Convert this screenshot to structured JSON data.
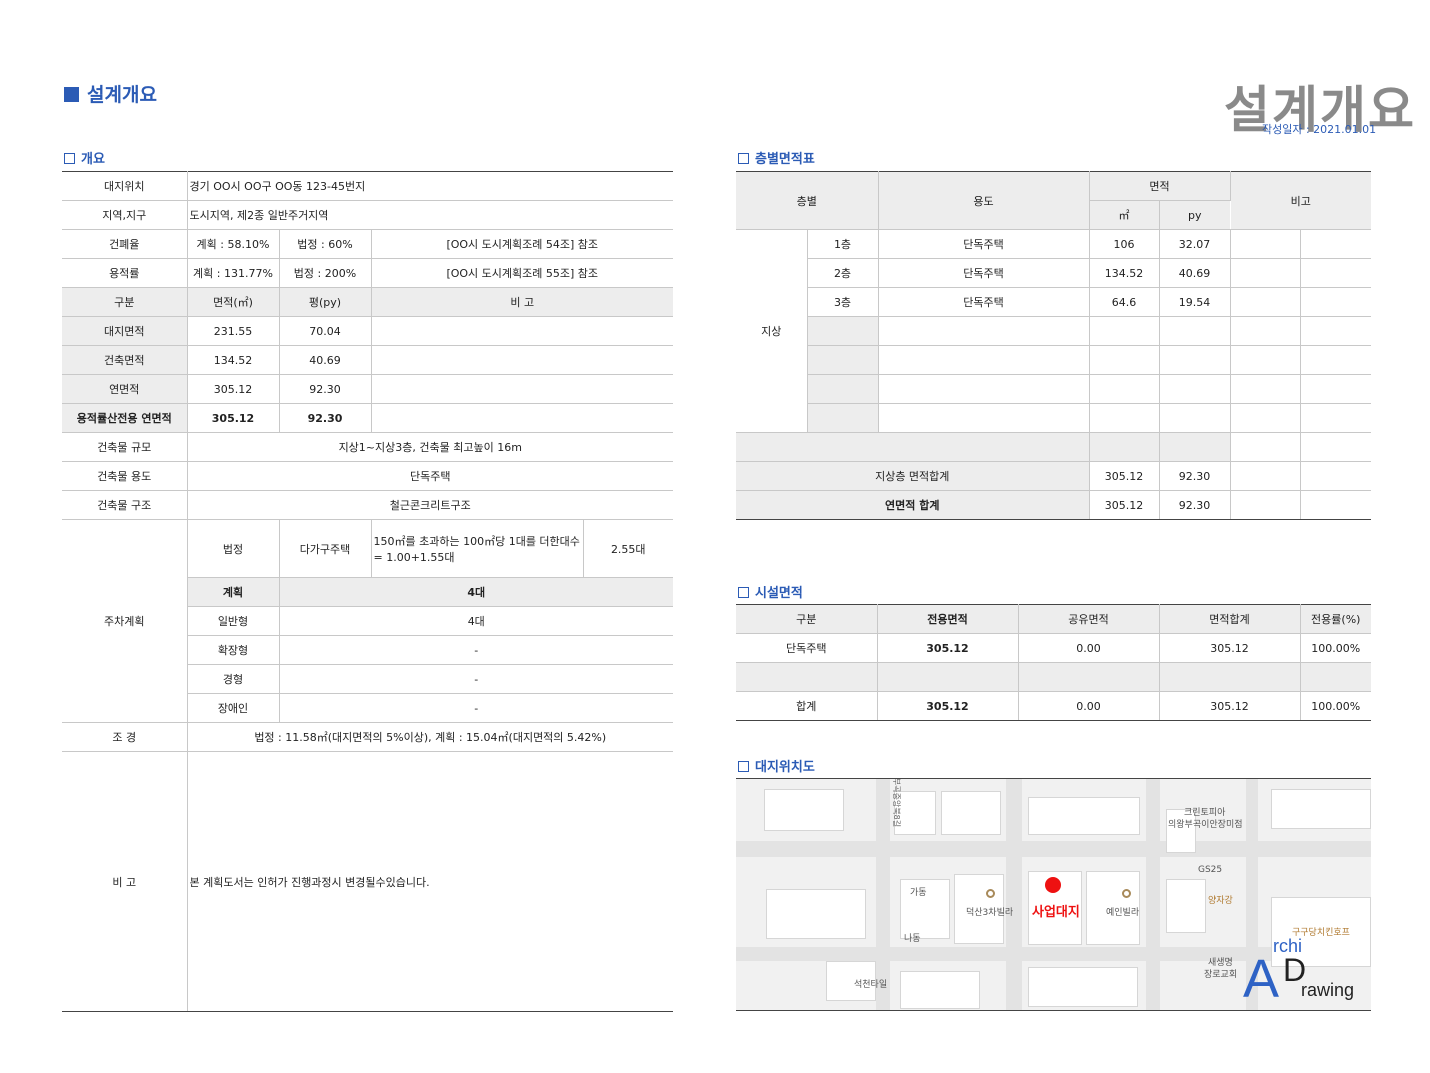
{
  "header": {
    "heading": "설계개요",
    "big_title": "설계개요",
    "date": "작성일자 : 2021.01.01"
  },
  "sections": {
    "overview": "개요",
    "floor": "층별면적표",
    "facility": "시설면적",
    "location": "대지위치도"
  },
  "overview": {
    "site_location": {
      "label": "대지위치",
      "value": "경기 OO시 OO구 OO동 123-45번지"
    },
    "zone": {
      "label": "지역,지구",
      "value": "도시지역, 제2종 일반주거지역"
    },
    "bcr": {
      "label": "건폐율",
      "plan": "계획 : 58.10%",
      "legal": "법정 : 60%",
      "ref": "[OO시 도시계획조례 54조] 참조"
    },
    "far": {
      "label": "용적률",
      "plan": "계획 : 131.77%",
      "legal": "법정 : 200%",
      "ref": "[OO시 도시계획조례 55조] 참조"
    },
    "area_header": {
      "c1": "구분",
      "c2": "면적(㎡)",
      "c3": "평(py)",
      "c4": "비 고"
    },
    "area_rows": [
      {
        "label": "대지면적",
        "m2": "231.55",
        "py": "70.04"
      },
      {
        "label": "건축면적",
        "m2": "134.52",
        "py": "40.69"
      },
      {
        "label": "연면적",
        "m2": "305.12",
        "py": "92.30"
      },
      {
        "label": "용적률산전용 연면적",
        "m2": "305.12",
        "py": "92.30"
      }
    ],
    "scale": {
      "label": "건축물 규모",
      "value": "지상1~지상3층, 건축물 최고높이 16m"
    },
    "use": {
      "label": "건축물 용도",
      "value": "단독주택"
    },
    "structure": {
      "label": "건축물 구조",
      "value": "철근콘크리트구조"
    },
    "parking": {
      "label": "주차계획",
      "legal_label": "법정",
      "legal_type": "다가구주택",
      "legal_rule": "150㎡를 초과하는 100㎡당 1대를 더한대수 = 1.00+1.55대",
      "legal_value": "2.55대",
      "plan_label": "계획",
      "plan_value": "4대",
      "rows": [
        {
          "label": "일반형",
          "value": "4대"
        },
        {
          "label": "확장형",
          "value": "-"
        },
        {
          "label": "경형",
          "value": "-"
        },
        {
          "label": "장애인",
          "value": "-"
        }
      ]
    },
    "landscape": {
      "label": "조 경",
      "value": "법정 : 11.58㎡(대지면적의 5%이상), 계획 : 15.04㎡(대지면적의 5.42%)"
    },
    "remarks": {
      "label": "비 고",
      "value": "본 계획도서는 인허가 진행과정시 변경될수있습니다."
    }
  },
  "floor_table": {
    "headers": {
      "floor": "층별",
      "use": "용도",
      "area": "면적",
      "m2": "㎡",
      "py": "py",
      "note": "비고"
    },
    "group_label": "지상",
    "rows": [
      {
        "floor": "1층",
        "use": "단독주택",
        "m2": "106",
        "py": "32.07"
      },
      {
        "floor": "2층",
        "use": "단독주택",
        "m2": "134.52",
        "py": "40.69"
      },
      {
        "floor": "3층",
        "use": "단독주택",
        "m2": "64.6",
        "py": "19.54"
      }
    ],
    "subtotal": {
      "label": "지상층 면적합계",
      "m2": "305.12",
      "py": "92.30"
    },
    "total": {
      "label": "연면적 합계",
      "m2": "305.12",
      "py": "92.30"
    }
  },
  "facility_table": {
    "headers": [
      "구분",
      "전용면적",
      "공유면적",
      "면적합계",
      "전용률(%)"
    ],
    "row": [
      "단독주택",
      "305.12",
      "0.00",
      "305.12",
      "100.00%"
    ],
    "total": [
      "합계",
      "305.12",
      "0.00",
      "305.12",
      "100.00%"
    ]
  },
  "map": {
    "site_label": "사업대지",
    "labels": {
      "villa1": "덕산3차빌라",
      "villa2": "예인빌라",
      "clinic": "크린토피아",
      "clinic2": "의왕부곡이안장미점",
      "gs": "GS25",
      "yangjagang": "양자강",
      "chicken": "구구당치킨호프",
      "church1": "새생명",
      "church2": "장로교회",
      "tile": "석천타일",
      "gadong": "가동",
      "nadong": "나동",
      "road": "부곡중앙북8길"
    },
    "logo": {
      "a": "A",
      "rchi": "rchi",
      "d": "D",
      "rawing": "rawing"
    }
  }
}
